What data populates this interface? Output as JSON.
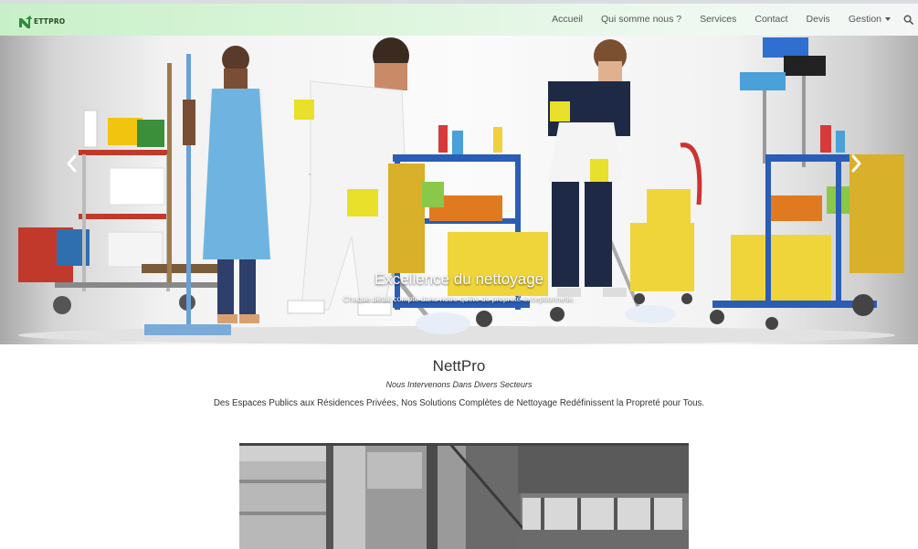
{
  "brand": {
    "name": "ETTPRO",
    "logo_icon": "nettpro-n-logo-icon"
  },
  "nav": {
    "items": [
      {
        "label": "Accueil"
      },
      {
        "label": "Qui somme nous ?"
      },
      {
        "label": "Services"
      },
      {
        "label": "Contact"
      },
      {
        "label": "Devis"
      },
      {
        "label": "Gestion"
      }
    ],
    "search_icon": "search-icon"
  },
  "carousel": {
    "caption_title": "Excellence du nettoyage",
    "caption_subtitle": "Chaque détail compte dans notre quête de propreté exceptionnelle.",
    "prev_icon": "chevron-left-icon",
    "next_icon": "chevron-right-icon"
  },
  "intro": {
    "title": "NettPro",
    "subtitle": "Nous Intervenons Dans Divers Secteurs",
    "description": "Des Espaces Publics aux Résidences Privées, Nos Solutions Complètes de Nettoyage Redéfinissent la Propreté pour Tous."
  },
  "colors": {
    "navbar_start": "#c8f0c8",
    "navbar_end": "#f4f6f6",
    "logo_green": "#2e8b3a",
    "text": "#333333"
  }
}
